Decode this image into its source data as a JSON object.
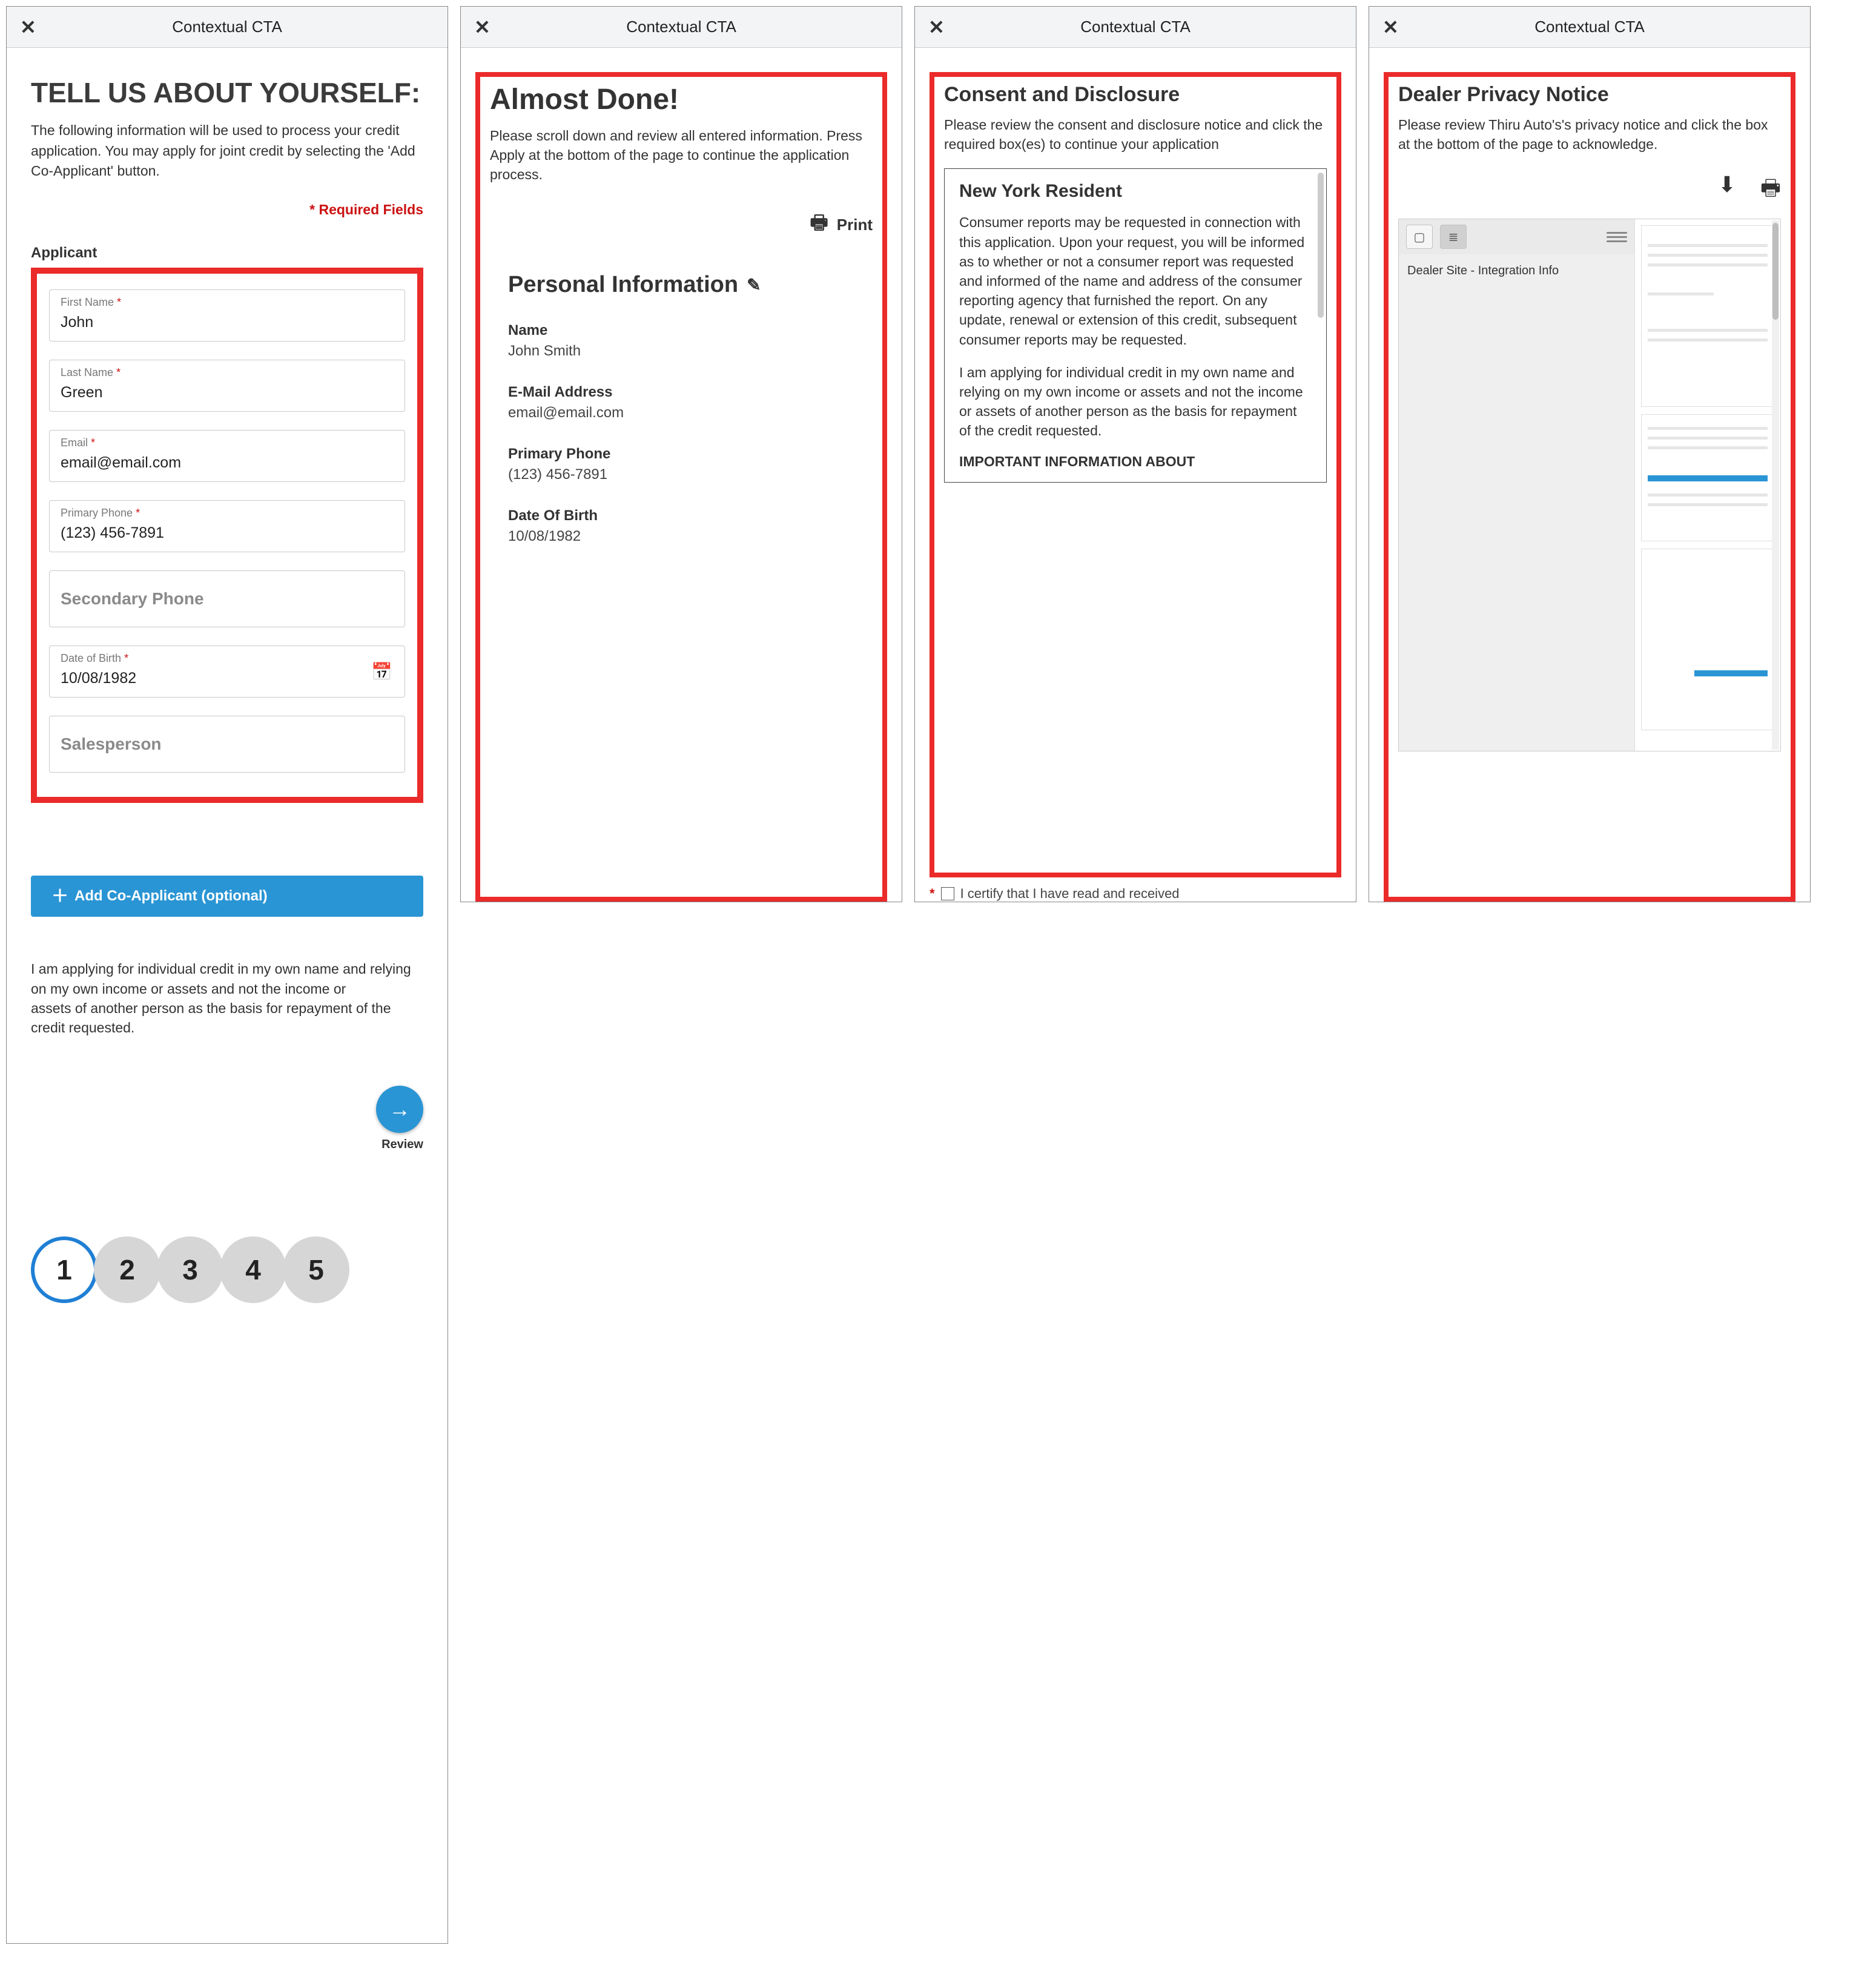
{
  "header_title": "Contextual CTA",
  "panel1": {
    "heading": "TELL US ABOUT YOURSELF:",
    "lead": "The following information will be used to process your credit application. You may apply for joint credit by selecting the 'Add Co-Applicant' button.",
    "required_note": "* Required Fields",
    "section_label": "Applicant",
    "fields": {
      "first_name": {
        "label": "First Name",
        "value": "John",
        "required": true
      },
      "last_name": {
        "label": "Last Name",
        "value": "Green",
        "required": true
      },
      "email": {
        "label": "Email",
        "value": "email@email.com",
        "required": true
      },
      "primary_phone": {
        "label": "Primary Phone",
        "value": "(123) 456-7891",
        "required": true
      },
      "secondary_phone": {
        "placeholder": "Secondary Phone"
      },
      "dob": {
        "label": "Date of Birth",
        "value": "10/08/1982",
        "required": true
      },
      "salesperson": {
        "placeholder": "Salesperson"
      }
    },
    "add_coapp_label": "Add Co-Applicant (optional)",
    "disclaimer_l1": "I am applying for individual credit in my own name and relying on my own income or assets and not the income or",
    "disclaimer_l2": "assets of another person as the basis for repayment of the credit requested.",
    "review_label": "Review",
    "steps": [
      "1",
      "2",
      "3",
      "4",
      "5"
    ]
  },
  "panel2": {
    "heading": "Almost Done!",
    "sub": "Please scroll down and review all entered information. Press Apply at the bottom of the page to continue the application process.",
    "print_label": "Print",
    "section_title": "Personal Information",
    "name_k": "Name",
    "name_v": "John Smith",
    "email_k": "E-Mail Address",
    "email_v": "email@email.com",
    "phone_k": "Primary Phone",
    "phone_v": "(123) 456-7891",
    "dob_k": "Date Of Birth",
    "dob_v": "10/08/1982"
  },
  "panel3": {
    "heading": "Consent and Disclosure",
    "sub": "Please review the consent and disclosure notice and click the required box(es) to continue your application",
    "box_title": "New York Resident",
    "p1": "Consumer reports may be requested in connection with this application. Upon your request, you will be informed as to whether or not a consumer report was requested and informed of the name and address of the consumer reporting agency that furnished the report. On any update, renewal or extension of this credit, subsequent consumer reports may be requested.",
    "p2": "I am applying for individual credit in my own name and relying on my own income or assets and not the income or assets of another person as the basis for repayment of the credit requested.",
    "imp": "IMPORTANT INFORMATION ABOUT",
    "certify": "I certify that I have read and received"
  },
  "panel4": {
    "heading": "Dealer Privacy Notice",
    "sub": "Please review Thiru Auto's's privacy notice and click the box at the bottom of the page to acknowledge.",
    "doc_title": "Dealer Site - Integration Info"
  }
}
